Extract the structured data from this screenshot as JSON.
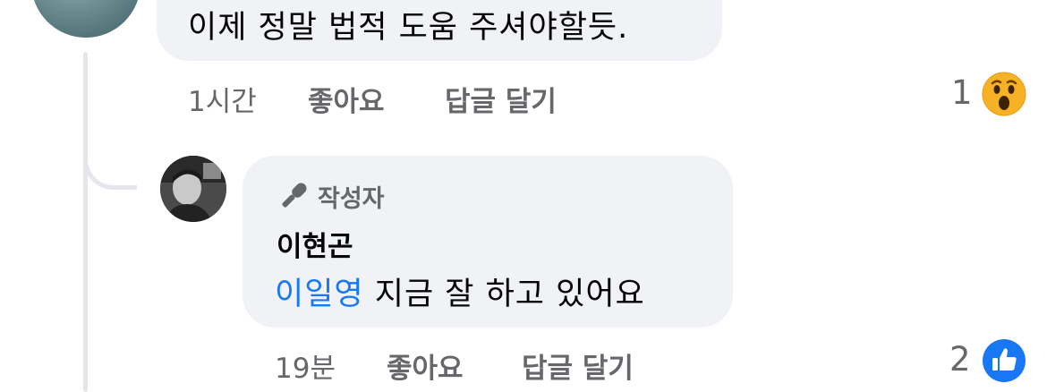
{
  "parent_comment": {
    "text": "이제 정말 법적 도움 주셔야할듯.",
    "time": "1시간",
    "like_label": "좋아요",
    "reply_label": "답글 달기",
    "reaction_count": "1",
    "reaction_icon": "wow-emoji-icon"
  },
  "reply_comment": {
    "badge_label": "작성자",
    "badge_icon": "microphone-icon",
    "author": "이현곤",
    "mention": "이일영",
    "text": "지금 잘 하고 있어요",
    "time": "19분",
    "like_label": "좋아요",
    "reply_label": "답글 달기",
    "reaction_count": "2",
    "reaction_icon": "like-thumb-icon"
  },
  "colors": {
    "bubble": "#f0f2f5",
    "meta_text": "#65676b",
    "mention": "#1877f2",
    "like_blue": "#1877f2",
    "wow_yellow": "#f7b125"
  }
}
